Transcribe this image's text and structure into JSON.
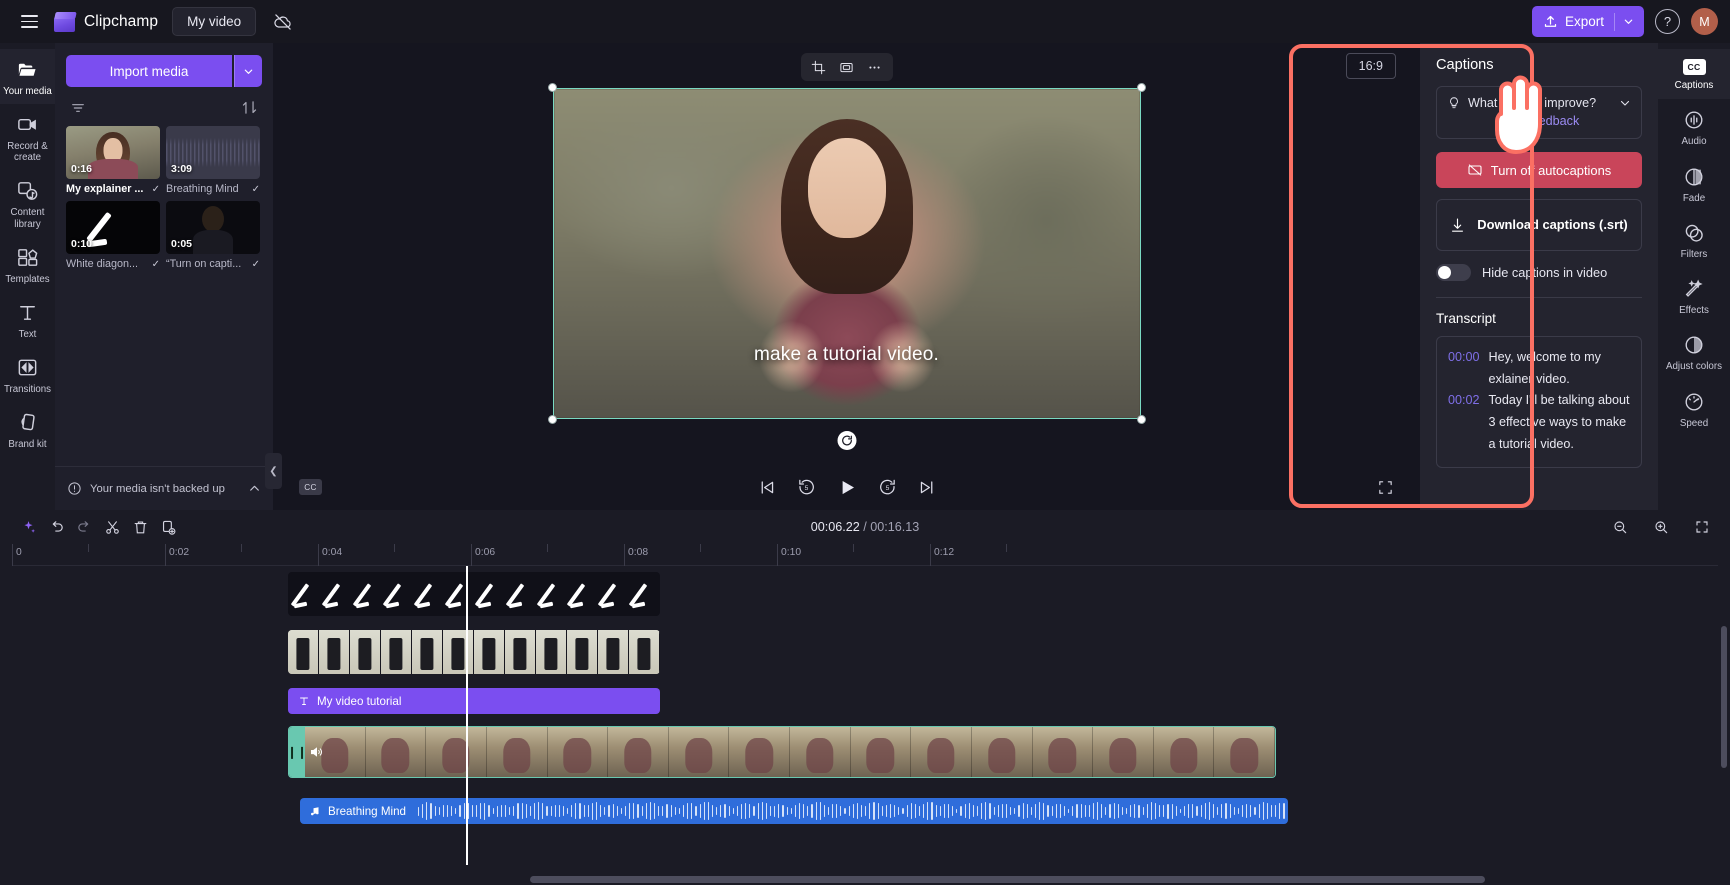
{
  "header": {
    "menu_label": "menu",
    "brand": "Clipchamp",
    "project_name": "My video",
    "cloud_status": "cloud-off",
    "export_label": "Export",
    "help_label": "?",
    "avatar_initial": "M"
  },
  "left_rail": [
    {
      "label": "Your media",
      "icon": "folder-icon",
      "active": true
    },
    {
      "label": "Record & create",
      "icon": "camera-icon",
      "active": false
    },
    {
      "label": "Content library",
      "icon": "library-icon",
      "active": false
    },
    {
      "label": "Templates",
      "icon": "templates-icon",
      "active": false
    },
    {
      "label": "Text",
      "icon": "text-icon",
      "active": false
    },
    {
      "label": "Transitions",
      "icon": "transitions-icon",
      "active": false
    },
    {
      "label": "Brand kit",
      "icon": "brandkit-icon",
      "active": false
    }
  ],
  "media_panel": {
    "import_label": "Import media",
    "filter_icon": "filter-icon",
    "sort_icon": "sort-icon",
    "items": [
      {
        "name": "My explainer ...",
        "duration": "0:16",
        "selected": true,
        "checked": true
      },
      {
        "name": "Breathing Mind",
        "duration": "3:09",
        "selected": false,
        "checked": true
      },
      {
        "name": "White diagon...",
        "duration": "0:10",
        "selected": false,
        "checked": true
      },
      {
        "name": "“Turn on capti...",
        "duration": "0:05",
        "selected": false,
        "checked": true
      }
    ],
    "backup_notice": "Your media isn't backed up"
  },
  "preview": {
    "aspect_ratio": "16:9",
    "toolbar": [
      "crop-icon",
      "fit-icon",
      "more-icon"
    ],
    "caption_text": "make a tutorial video.",
    "cc_label": "CC",
    "transport": [
      "skip-previous-icon",
      "rewind-5-icon",
      "play-icon",
      "forward-5-icon",
      "skip-next-icon"
    ],
    "fullscreen_icon": "fullscreen-icon"
  },
  "timeline": {
    "tools": [
      "magic-icon",
      "undo-icon",
      "redo-icon",
      "split-icon",
      "delete-icon",
      "duplicate-icon"
    ],
    "current_time": "00:06.22",
    "total_time": "/ 00:16.13",
    "zoom_out_icon": "zoom-out-icon",
    "zoom_in_icon": "zoom-in-icon",
    "fit_icon": "fit-timeline-icon",
    "ruler_ticks": [
      "0",
      "0:02",
      "0:04",
      "0:06",
      "0:08",
      "0:10",
      "0:12"
    ],
    "text_clip_label": "My video tutorial",
    "audio_clip_label": "Breathing Mind"
  },
  "captions_panel": {
    "title": "Captions",
    "feedback_prompt": "What can we improve?",
    "feedback_link": "Give feedback",
    "turn_off_label": "Turn off autocaptions",
    "download_label": "Download captions (.srt)",
    "hide_toggle_label": "Hide captions in video",
    "transcript_title": "Transcript",
    "transcript": [
      {
        "time": "00:00",
        "text": "Hey, welcome to my exlainer video."
      },
      {
        "time": "00:02",
        "text": "Today I'll be talking about 3 effective ways to make a tutorial video."
      }
    ]
  },
  "right_rail": [
    {
      "label": "Captions",
      "icon": "cc-icon",
      "active": true
    },
    {
      "label": "Audio",
      "icon": "audio-icon",
      "active": false
    },
    {
      "label": "Fade",
      "icon": "fade-icon",
      "active": false
    },
    {
      "label": "Filters",
      "icon": "filters-icon",
      "active": false
    },
    {
      "label": "Effects",
      "icon": "effects-icon",
      "active": false
    },
    {
      "label": "Adjust colors",
      "icon": "adjust-colors-icon",
      "active": false
    },
    {
      "label": "Speed",
      "icon": "speed-icon",
      "active": false
    }
  ],
  "colors": {
    "accent_purple": "#7b4ef0",
    "danger_red": "#c9455a",
    "highlight_ring": "#fb7063",
    "selection_teal": "#79d9c2",
    "audio_blue": "#2f6ddb"
  }
}
